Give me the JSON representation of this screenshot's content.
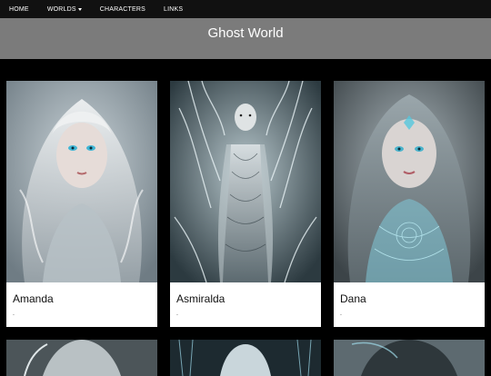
{
  "nav": {
    "items": [
      {
        "label": "HOME"
      },
      {
        "label": "WORLDS"
      },
      {
        "label": "CHARACTERS"
      },
      {
        "label": "LINKS"
      }
    ]
  },
  "header": {
    "title": "Ghost World"
  },
  "cards": [
    {
      "name": "Amanda",
      "desc": "."
    },
    {
      "name": "Asmiralda",
      "desc": "."
    },
    {
      "name": "Dana",
      "desc": "."
    }
  ],
  "colors": {
    "navbar": "#111111",
    "header": "#7b7b7b",
    "background": "#000000",
    "card": "#ffffff"
  }
}
